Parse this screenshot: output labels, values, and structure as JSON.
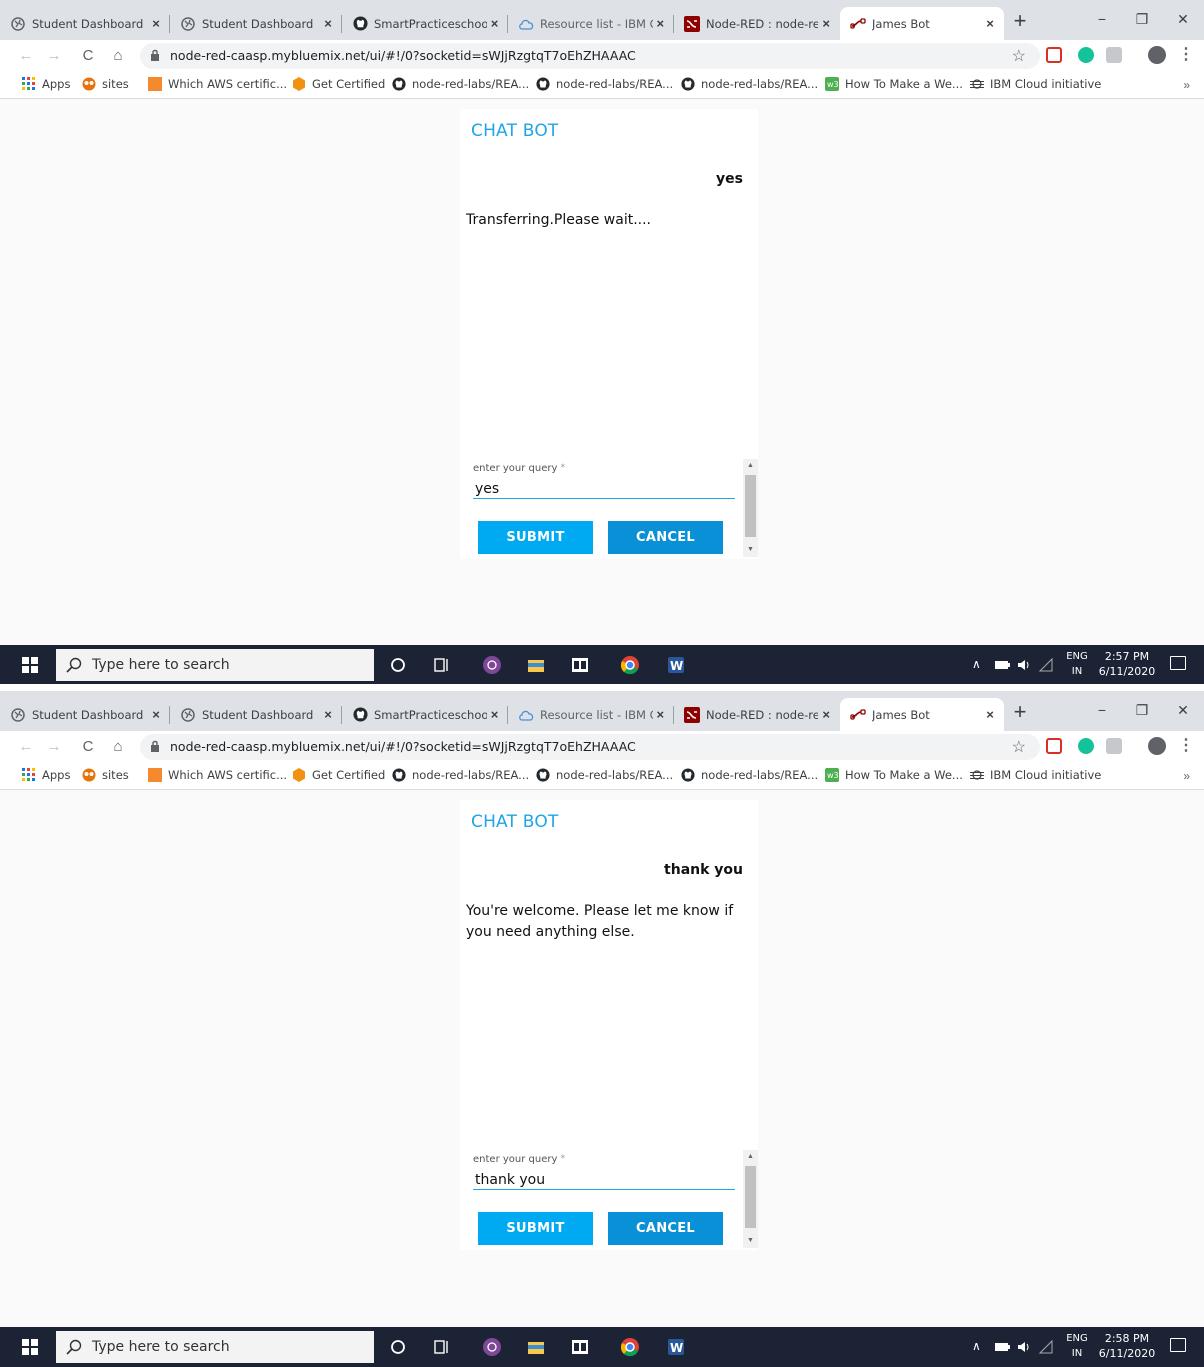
{
  "browser": {
    "tabs": [
      {
        "title": "Student Dashboard",
        "close": "×"
      },
      {
        "title": "Student Dashboard",
        "close": "×"
      },
      {
        "title": "SmartPracticeschool/",
        "close": "×"
      },
      {
        "title": "Resource list - IBM C",
        "close": "×"
      },
      {
        "title": "Node-RED : node-re",
        "close": "×"
      },
      {
        "title": "James Bot",
        "close": "×"
      }
    ],
    "new_tab": "+",
    "window_controls": [
      "−",
      "❐",
      "✕"
    ],
    "nav": {
      "back": "←",
      "forward": "→",
      "reload": "C",
      "home": "⌂"
    },
    "url": "node-red-caasp.mybluemix.net/ui/#!/0?socketid=sWJjRzgtqT7oEhZHAAAC",
    "star": "☆",
    "menu": "⋮",
    "bookmarks": [
      {
        "label": "Apps",
        "icon": "apps-grid-icon"
      },
      {
        "label": "sites",
        "icon": "sites-icon"
      },
      {
        "label": "Which AWS certific...",
        "icon": "aws-icon"
      },
      {
        "label": "Get Certified",
        "icon": "hexagon-icon"
      },
      {
        "label": "node-red-labs/REA...",
        "icon": "github-icon"
      },
      {
        "label": "node-red-labs/REA...",
        "icon": "github-icon"
      },
      {
        "label": "node-red-labs/REA...",
        "icon": "github-icon"
      },
      {
        "label": "How To Make a We...",
        "icon": "w3-icon"
      },
      {
        "label": "IBM Cloud initiative",
        "icon": "ibm-icon"
      }
    ],
    "bookmarks_more": "»",
    "colors": {
      "tab_strip": "#dee1e6",
      "omnibox": "#f1f3f4"
    }
  },
  "screens": [
    {
      "chat": {
        "title": "CHAT BOT",
        "user_message": "yes",
        "bot_message": "Transferring.Please wait....",
        "input_label": "enter your query",
        "required_mark": "*",
        "input_value": "yes",
        "submit_label": "SUBMIT",
        "cancel_label": "CANCEL"
      },
      "taskbar": {
        "search_placeholder": "Type here to search",
        "lang_top": "ENG",
        "lang_bottom": "IN",
        "time": "2:57 PM",
        "date": "6/11/2020"
      }
    },
    {
      "chat": {
        "title": "CHAT BOT",
        "user_message": "thank you",
        "bot_message": "You're welcome. Please let me know if you need anything else.",
        "input_label": "enter your query",
        "required_mark": "*",
        "input_value": "thank you",
        "submit_label": "SUBMIT",
        "cancel_label": "CANCEL"
      },
      "taskbar": {
        "search_placeholder": "Type here to search",
        "lang_top": "ENG",
        "lang_bottom": "IN",
        "time": "2:58 PM",
        "date": "6/11/2020"
      }
    }
  ],
  "theme": {
    "accent": "#1fa5e8",
    "submit": "#00aaf3",
    "cancel": "#0a90d6",
    "taskbar": "#1b2334"
  }
}
